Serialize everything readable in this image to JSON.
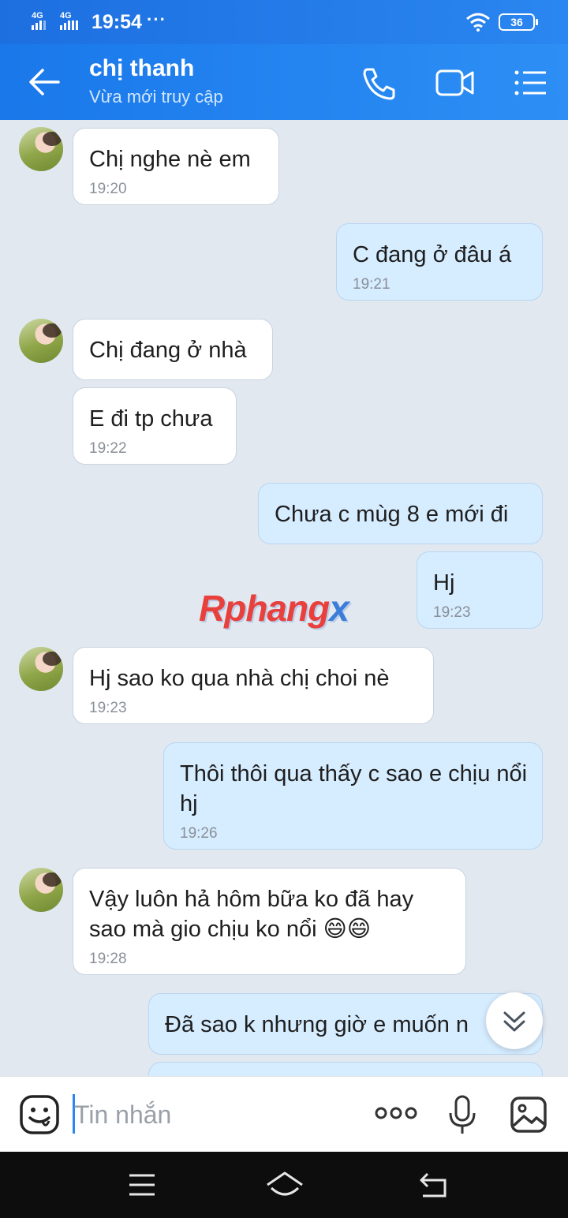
{
  "status_bar": {
    "signal1": "4G",
    "signal2": "4G",
    "time": "19:54",
    "more": "···",
    "battery": "36"
  },
  "header": {
    "contact_name": "chị thanh",
    "contact_status": "Vừa mới truy cập"
  },
  "messages": [
    {
      "side": "in",
      "text": "Chị nghe nè em",
      "time": "19:20"
    },
    {
      "side": "out",
      "text": "C đang ở đâu á",
      "time": "19:21"
    },
    {
      "side": "in",
      "text": "Chị đang ở nhà",
      "time": ""
    },
    {
      "side": "in",
      "text": "E đi tp chưa",
      "time": "19:22"
    },
    {
      "side": "out",
      "text": "Chưa c mùg 8 e mới đi",
      "time": ""
    },
    {
      "side": "out",
      "text": "Hj",
      "time": "19:23"
    },
    {
      "side": "in",
      "text": "Hj sao ko qua nhà chị choi nè",
      "time": "19:23"
    },
    {
      "side": "out",
      "text": "Thôi thôi qua thấy c sao e chịu nổi hj",
      "time": "19:26"
    },
    {
      "side": "in",
      "text": "Vậy luôn hả  hôm bữa ko đã hay sao mà gio chịu ko nổi 😄😄",
      "time": "19:28"
    },
    {
      "side": "out",
      "text": "Đã sao k nhưng giờ e muốn n",
      "time": ""
    }
  ],
  "watermark": {
    "main": "Rphang",
    "accent": "x"
  },
  "input": {
    "placeholder": "Tin nhắn"
  },
  "colors": {
    "header": "#1a78ea",
    "bubble_out": "#d6ecff",
    "bubble_in": "#ffffff",
    "chat_bg": "#e2e8f0"
  }
}
